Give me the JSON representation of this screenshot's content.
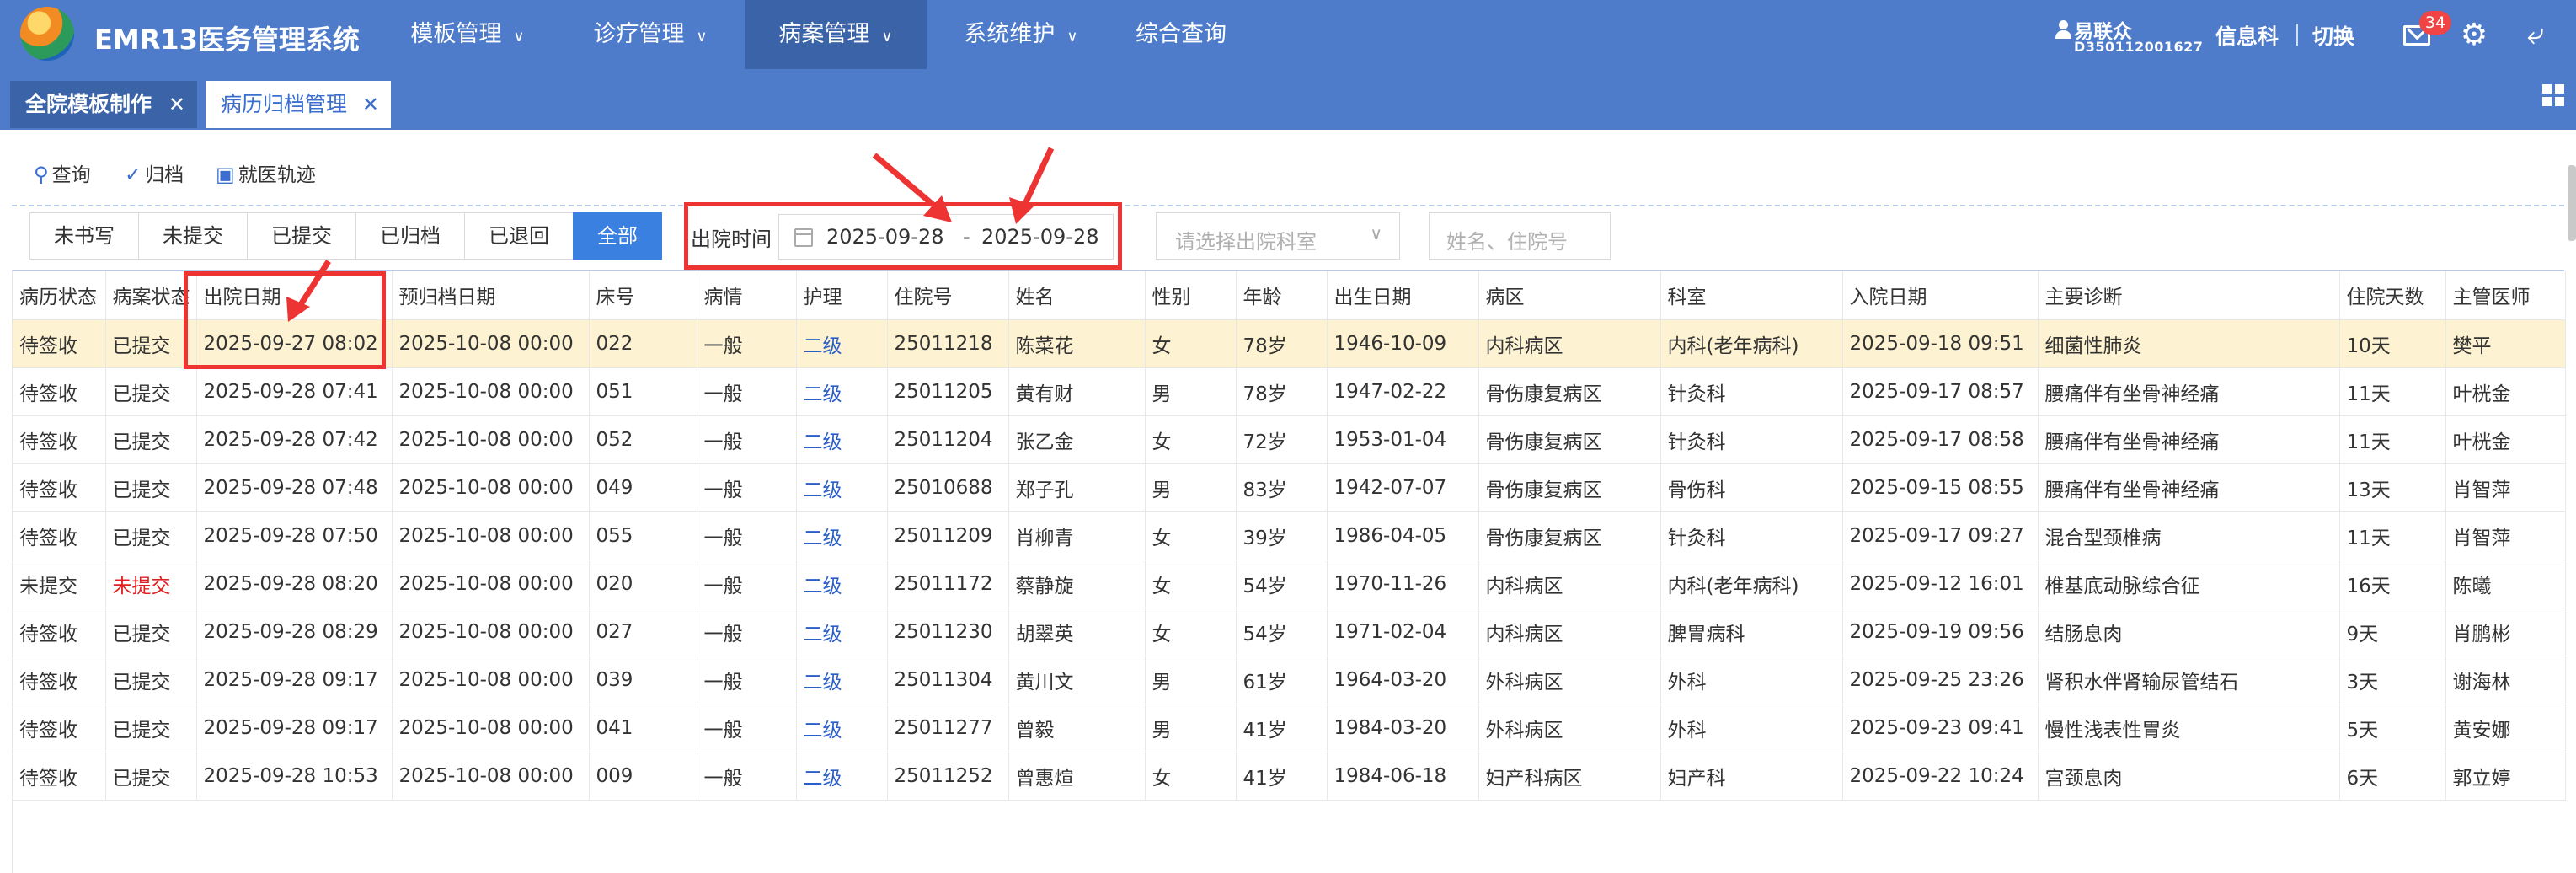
{
  "app": {
    "title": "EMR13医务管理系统"
  },
  "nav": [
    {
      "label": "模板管理"
    },
    {
      "label": "诊疗管理"
    },
    {
      "label": "病案管理"
    },
    {
      "label": "系统维护"
    },
    {
      "label": "综合查询"
    }
  ],
  "user": {
    "name": "易联众",
    "id": "D350112001627",
    "dept": "信息科",
    "switch_label": "切换",
    "mail_count": "34"
  },
  "icons": {
    "mail": "mail-icon",
    "settings": "gear-icon",
    "back": "back-icon",
    "grid": "grid-icon",
    "user": "user-icon",
    "calendar": "calendar-icon"
  },
  "tabs": [
    {
      "label": "全院模板制作"
    },
    {
      "label": "病历归档管理"
    }
  ],
  "toolbar": {
    "query": "查询",
    "archive": "归档",
    "track": "就医轨迹"
  },
  "filter": {
    "segments": [
      "未书写",
      "未提交",
      "已提交",
      "已归档",
      "已退回",
      "全部"
    ],
    "date_label": "出院时间",
    "date_start": "2025-09-28",
    "date_sep": "-",
    "date_end": "2025-09-28",
    "dept_placeholder": "请选择出院科室",
    "search_placeholder": "姓名、住院号"
  },
  "colors": {
    "header_bg": "#4e7ccb",
    "active_nav": "#3a63a8",
    "active_segment": "#3a80e0",
    "highlight_row": "#fdf3d2",
    "annotation": "#ee3333"
  },
  "table": {
    "headers": [
      "病历状态",
      "病案状态",
      "出院日期",
      "预归档日期",
      "床号",
      "病情",
      "护理",
      "住院号",
      "姓名",
      "性别",
      "年龄",
      "出生日期",
      "病区",
      "科室",
      "入院日期",
      "主要诊断",
      "住院天数",
      "主管医师"
    ],
    "rows": [
      [
        "待签收",
        "已提交",
        "2025-09-27 08:02",
        "2025-10-08 00:00",
        "022",
        "一般",
        "二级",
        "25011218",
        "陈菜花",
        "女",
        "78岁",
        "1946-10-09",
        "内科病区",
        "内科(老年病科)",
        "2025-09-18 09:51",
        "细菌性肺炎",
        "10天",
        "樊平"
      ],
      [
        "待签收",
        "已提交",
        "2025-09-28 07:41",
        "2025-10-08 00:00",
        "051",
        "一般",
        "二级",
        "25011205",
        "黄有财",
        "男",
        "78岁",
        "1947-02-22",
        "骨伤康复病区",
        "针灸科",
        "2025-09-17 08:57",
        "腰痛伴有坐骨神经痛",
        "11天",
        "叶桄金"
      ],
      [
        "待签收",
        "已提交",
        "2025-09-28 07:42",
        "2025-10-08 00:00",
        "052",
        "一般",
        "二级",
        "25011204",
        "张乙金",
        "女",
        "72岁",
        "1953-01-04",
        "骨伤康复病区",
        "针灸科",
        "2025-09-17 08:58",
        "腰痛伴有坐骨神经痛",
        "11天",
        "叶桄金"
      ],
      [
        "待签收",
        "已提交",
        "2025-09-28 07:48",
        "2025-10-08 00:00",
        "049",
        "一般",
        "二级",
        "25010688",
        "郑子孔",
        "男",
        "83岁",
        "1942-07-07",
        "骨伤康复病区",
        "骨伤科",
        "2025-09-15 08:55",
        "腰痛伴有坐骨神经痛",
        "13天",
        "肖智萍"
      ],
      [
        "待签收",
        "已提交",
        "2025-09-28 07:50",
        "2025-10-08 00:00",
        "055",
        "一般",
        "二级",
        "25011209",
        "肖柳青",
        "女",
        "39岁",
        "1986-04-05",
        "骨伤康复病区",
        "针灸科",
        "2025-09-17 09:27",
        "混合型颈椎病",
        "11天",
        "肖智萍"
      ],
      [
        "未提交",
        "未提交",
        "2025-09-28 08:20",
        "2025-10-08 00:00",
        "020",
        "一般",
        "二级",
        "25011172",
        "蔡静旋",
        "女",
        "54岁",
        "1970-11-26",
        "内科病区",
        "内科(老年病科)",
        "2025-09-12 16:01",
        "椎基底动脉综合征",
        "16天",
        "陈曦"
      ],
      [
        "待签收",
        "已提交",
        "2025-09-28 08:29",
        "2025-10-08 00:00",
        "027",
        "一般",
        "二级",
        "25011230",
        "胡翠英",
        "女",
        "54岁",
        "1971-02-04",
        "内科病区",
        "脾胃病科",
        "2025-09-19 09:56",
        "结肠息肉",
        "9天",
        "肖鹏彬"
      ],
      [
        "待签收",
        "已提交",
        "2025-09-28 09:17",
        "2025-10-08 00:00",
        "039",
        "一般",
        "二级",
        "25011304",
        "黄川文",
        "男",
        "61岁",
        "1964-03-20",
        "外科病区",
        "外科",
        "2025-09-25 23:26",
        "肾积水伴肾输尿管结石",
        "3天",
        "谢海林"
      ],
      [
        "待签收",
        "已提交",
        "2025-09-28 09:17",
        "2025-10-08 00:00",
        "041",
        "一般",
        "二级",
        "25011277",
        "曾毅",
        "男",
        "41岁",
        "1984-03-20",
        "外科病区",
        "外科",
        "2025-09-23 09:41",
        "慢性浅表性胃炎",
        "5天",
        "黄安娜"
      ],
      [
        "待签收",
        "已提交",
        "2025-09-28 10:53",
        "2025-10-08 00:00",
        "009",
        "一般",
        "二级",
        "25011252",
        "曾惠煊",
        "女",
        "41岁",
        "1984-06-18",
        "妇产科病区",
        "妇产科",
        "2025-09-22 10:24",
        "宫颈息肉",
        "6天",
        "郭立婷"
      ]
    ]
  }
}
